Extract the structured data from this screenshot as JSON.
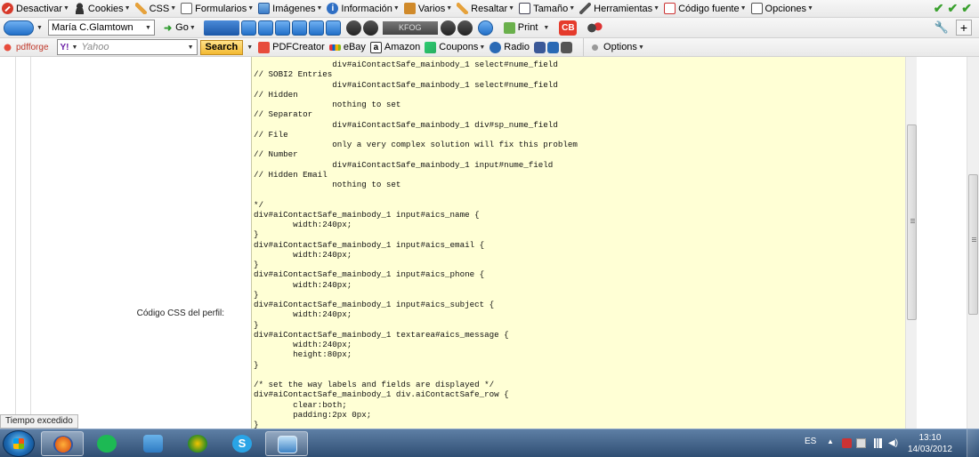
{
  "toolbar1": {
    "items": [
      {
        "label": "Desactivar",
        "icon": "stop-icon"
      },
      {
        "label": "Cookies",
        "icon": "user-icon"
      },
      {
        "label": "CSS",
        "icon": "pencil-icon"
      },
      {
        "label": "Formularios",
        "icon": "form-icon"
      },
      {
        "label": "Imágenes",
        "icon": "image-icon"
      },
      {
        "label": "Información",
        "icon": "info-icon"
      },
      {
        "label": "Varios",
        "icon": "tools-icon"
      },
      {
        "label": "Resaltar",
        "icon": "pencil-icon"
      },
      {
        "label": "Tamaño",
        "icon": "resize-icon"
      },
      {
        "label": "Herramientas",
        "icon": "wrench-icon"
      },
      {
        "label": "Código fuente",
        "icon": "source-icon"
      },
      {
        "label": "Opciones",
        "icon": "options-icon"
      }
    ]
  },
  "toolbar2": {
    "profile": "María C.Glamtown",
    "go_label": "Go",
    "kfog_label": "KFOG",
    "print_label": "Print",
    "cb_label": "CB"
  },
  "toolbar3": {
    "brand": "pdfforge",
    "search_placeholder": "Yahoo",
    "search_button": "Search",
    "links": [
      {
        "label": "PDFCreator",
        "icon": "pdfcreator-icon"
      },
      {
        "label": "eBay",
        "icon": "ebay-icon"
      },
      {
        "label": "Amazon",
        "icon": "amazon-icon"
      },
      {
        "label": "Coupons",
        "icon": "coupons-icon"
      },
      {
        "label": "Radio",
        "icon": "radio-icon"
      }
    ],
    "options_label": "Options"
  },
  "page": {
    "field_label": "Código CSS del perfil:",
    "code": "                div#aiContactSafe_mainbody_1 select#nume_field\n// SOBI2 Entries\n                div#aiContactSafe_mainbody_1 select#nume_field\n// Hidden\n                nothing to set\n// Separator\n                div#aiContactSafe_mainbody_1 div#sp_nume_field\n// File\n                only a very complex solution will fix this problem\n// Number\n                div#aiContactSafe_mainbody_1 input#nume_field\n// Hidden Email\n                nothing to set\n\n*/\ndiv#aiContactSafe_mainbody_1 input#aics_name {\n        width:240px;\n}\ndiv#aiContactSafe_mainbody_1 input#aics_email {\n        width:240px;\n}\ndiv#aiContactSafe_mainbody_1 input#aics_phone {\n        width:240px;\n}\ndiv#aiContactSafe_mainbody_1 input#aics_subject {\n        width:240px;\n}\ndiv#aiContactSafe_mainbody_1 textarea#aics_message {\n        width:240px;\n        height:80px;\n}\n\n/* set the way labels and fields are displayed */\ndiv#aiContactSafe_mainbody_1 div.aiContactSafe_row {\n        clear:both;\n        padding:2px 0px;\n}"
  },
  "status": "Tiempo excedido",
  "taskbar": {
    "language": "ES",
    "time": "13:10",
    "date": "14/03/2012",
    "apps": [
      {
        "name": "start"
      },
      {
        "name": "firefox"
      },
      {
        "name": "spotify"
      },
      {
        "name": "package"
      },
      {
        "name": "binoculars"
      },
      {
        "name": "skype"
      },
      {
        "name": "window"
      }
    ]
  },
  "colors": {
    "editor_bg": "#ffffd5",
    "search_button": "#f3b931",
    "taskbar": "#3b5b80"
  }
}
